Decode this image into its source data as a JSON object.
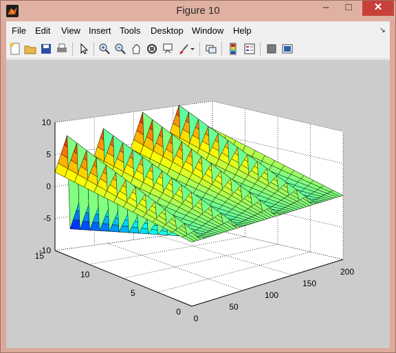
{
  "window": {
    "title": "Figure 10",
    "minimize": "–",
    "maximize": "□",
    "close": "✕"
  },
  "menu": [
    "File",
    "Edit",
    "View",
    "Insert",
    "Tools",
    "Desktop",
    "Window",
    "Help"
  ],
  "menu_arrow": "↘",
  "toolbar": [
    "new-figure",
    "open",
    "save",
    "print",
    "edit-plot",
    "zoom-in",
    "zoom-out",
    "pan",
    "rotate-3d",
    "data-cursor",
    "brush",
    "brush-menu",
    "link-plot",
    "colorbar",
    "legend",
    "hide-plot-tools",
    "show-plot-tools"
  ],
  "axes": {
    "z_ticks": [
      "10",
      "5",
      "0",
      "-5",
      "-10"
    ],
    "y_ticks": [
      "15",
      "10",
      "5",
      "0"
    ],
    "x_ticks": [
      "0",
      "50",
      "100",
      "150",
      "200"
    ]
  },
  "chart_data": {
    "type": "surface",
    "xlim": [
      0,
      200
    ],
    "ylim": [
      0,
      15
    ],
    "zlim": [
      -10,
      10
    ],
    "grid": true,
    "colormap": "jet",
    "description_values": {
      "x_ticks": [
        0,
        50,
        100,
        150,
        200
      ],
      "y_ticks": [
        0,
        5,
        10,
        15
      ],
      "z_ticks": [
        -10,
        -5,
        0,
        5,
        10
      ]
    },
    "series": [
      {
        "x": [
          0,
          25,
          50,
          75,
          100,
          125,
          150,
          175,
          200
        ],
        "y_max_amplitude": 8,
        "waves": 4
      }
    ]
  }
}
